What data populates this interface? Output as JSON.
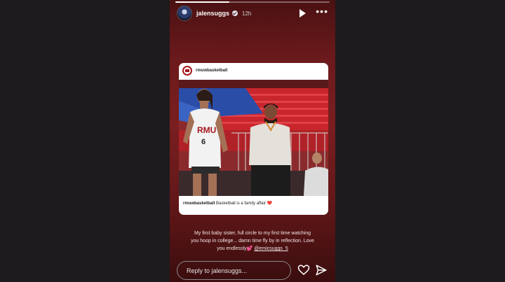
{
  "story": {
    "username": "jalensuggs",
    "time": "12h",
    "progress": 0.35
  },
  "post": {
    "username": "rmuwbasketball",
    "jersey_text": "RMU",
    "jersey_number": "6",
    "caption_user": "rmuwbasketball",
    "caption_text": "Basketball is a family affair",
    "caption_emoji": "❤️"
  },
  "caption": {
    "line1": "My first baby sister, full circle to my first time watching",
    "line2": "you hoop in college... damn time fly by in reflection. Love",
    "line3_text": "you endlessly",
    "line3_sparkle": "💕",
    "mention": "@emicsuggs_5"
  },
  "reply": {
    "placeholder": "Reply to jalensuggs..."
  }
}
